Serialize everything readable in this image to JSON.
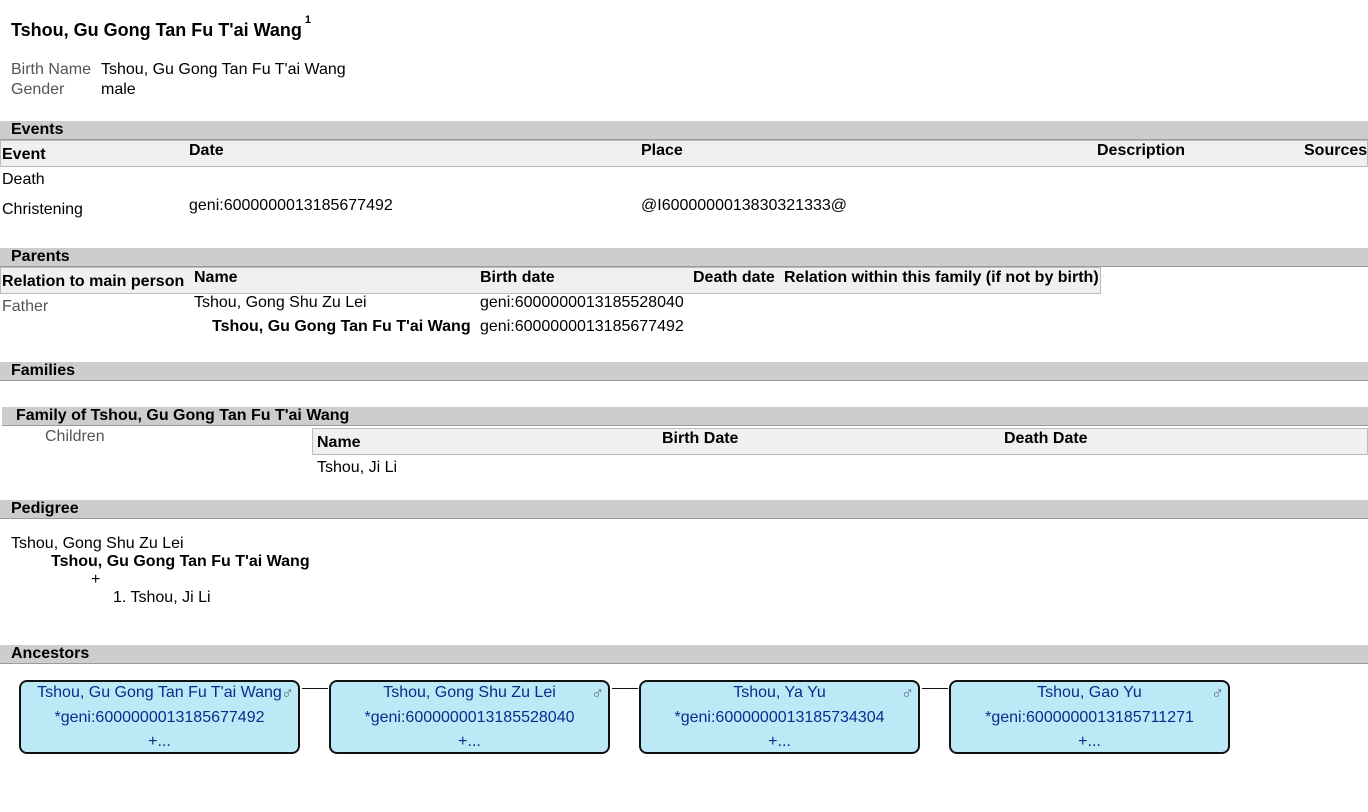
{
  "page": {
    "title": "Tshou, Gu Gong Tan Fu T'ai Wang",
    "title_sup": "1"
  },
  "summary": {
    "birth_name_label": "Birth Name",
    "birth_name_value": "Tshou, Gu Gong Tan Fu T'ai Wang",
    "gender_label": "Gender",
    "gender_value": "male"
  },
  "events": {
    "section_title": "Events",
    "headers": [
      "Event",
      "Date",
      "Place",
      "Description",
      "Sources"
    ],
    "rows": [
      {
        "event": "Death",
        "date": "",
        "place": ""
      },
      {
        "event": "Christening",
        "date": "geni:6000000013185677492",
        "place": "@I6000000013830321333@"
      }
    ]
  },
  "parents": {
    "section_title": "Parents",
    "headers": [
      "Relation to main person",
      "Name",
      "Birth date",
      "Death date",
      "Relation within this family (if not by birth)"
    ],
    "rows": [
      {
        "relation": "Father",
        "name": "Tshou, Gong Shu Zu Lei",
        "birth": "geni:6000000013185528040"
      },
      {
        "relation": "",
        "name": "Tshou, Gu Gong Tan Fu T'ai Wang",
        "birth": "geni:6000000013185677492"
      }
    ]
  },
  "families": {
    "section_title": "Families",
    "family_title": "Family of Tshou, Gu Gong Tan Fu T'ai Wang",
    "children_label": "Children",
    "headers": [
      "Name",
      "Birth Date",
      "Death Date"
    ],
    "children": [
      {
        "name": "Tshou, Ji Li"
      }
    ]
  },
  "pedigree": {
    "section_title": "Pedigree",
    "father": "Tshou, Gong Shu Zu Lei",
    "self": "Tshou, Gu Gong Tan Fu T'ai Wang",
    "plus": "+",
    "child": "1. Tshou, Ji Li"
  },
  "ancestors": {
    "section_title": "Ancestors",
    "gender_symbol": "♂",
    "boxes": [
      {
        "name": "Tshou, Gu Gong Tan Fu T'ai Wang",
        "id": "*geni:6000000013185677492",
        "more": "+..."
      },
      {
        "name": "Tshou, Gong Shu Zu Lei",
        "id": "*geni:6000000013185528040",
        "more": "+..."
      },
      {
        "name": "Tshou, Ya Yu",
        "id": "*geni:6000000013185734304",
        "more": "+..."
      },
      {
        "name": "Tshou, Gao Yu",
        "id": "*geni:6000000013185711271",
        "more": "+..."
      }
    ]
  }
}
